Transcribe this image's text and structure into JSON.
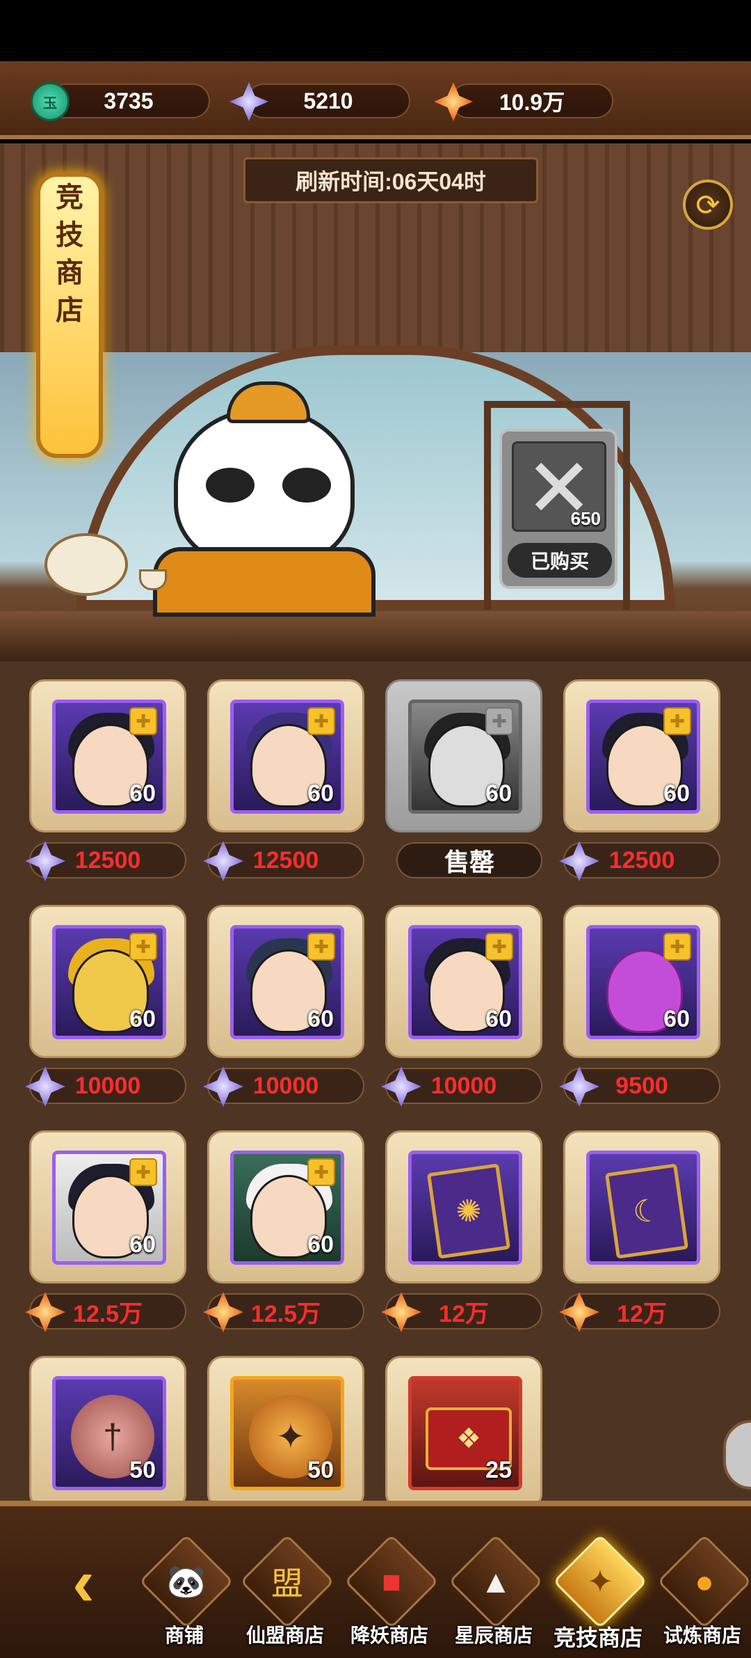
{
  "currencies": [
    {
      "icon": "jade-coin-icon",
      "value": "3735"
    },
    {
      "icon": "crystal-icon",
      "value": "5210"
    },
    {
      "icon": "arena-token-icon",
      "value": "10.9万"
    }
  ],
  "shop": {
    "banner_title": [
      "竞",
      "技",
      "商",
      "店"
    ],
    "refresh_label": "刷新时间:06天04时",
    "featured": {
      "quantity": "650",
      "status": "已购买"
    }
  },
  "items": [
    {
      "type": "hero",
      "quantity": "60",
      "price": "12500",
      "currency": "crystal"
    },
    {
      "type": "hero",
      "quantity": "60",
      "price": "12500",
      "currency": "crystal"
    },
    {
      "type": "hero",
      "quantity": "60",
      "price": "售罄",
      "currency": "none",
      "sold": true
    },
    {
      "type": "hero",
      "quantity": "60",
      "price": "12500",
      "currency": "crystal"
    },
    {
      "type": "hero",
      "quantity": "60",
      "price": "10000",
      "currency": "crystal"
    },
    {
      "type": "hero",
      "quantity": "60",
      "price": "10000",
      "currency": "crystal"
    },
    {
      "type": "hero",
      "quantity": "60",
      "price": "10000",
      "currency": "crystal"
    },
    {
      "type": "hero",
      "quantity": "60",
      "price": "9500",
      "currency": "crystal"
    },
    {
      "type": "hero",
      "quantity": "60",
      "price": "12.5万",
      "currency": "token"
    },
    {
      "type": "hero",
      "quantity": "60",
      "price": "12.5万",
      "currency": "token"
    },
    {
      "type": "card",
      "quantity": "",
      "price": "12万",
      "currency": "token"
    },
    {
      "type": "card",
      "quantity": "",
      "price": "12万",
      "currency": "token"
    },
    {
      "type": "coin-purple",
      "quantity": "50",
      "price": "",
      "currency": "none"
    },
    {
      "type": "coin-gold",
      "quantity": "50",
      "price": "",
      "currency": "none"
    },
    {
      "type": "chest",
      "quantity": "25",
      "price": "",
      "currency": "none"
    }
  ],
  "nav": {
    "tabs": [
      {
        "label": "商铺",
        "icon": "panda-icon"
      },
      {
        "label": "仙盟商店",
        "icon": "alliance-scroll-icon"
      },
      {
        "label": "降妖商店",
        "icon": "red-envelope-icon"
      },
      {
        "label": "星辰商店",
        "icon": "pagoda-icon"
      },
      {
        "label": "竞技商店",
        "icon": "arena-icon",
        "active": true
      },
      {
        "label": "试炼商店",
        "icon": "trial-icon"
      }
    ]
  }
}
